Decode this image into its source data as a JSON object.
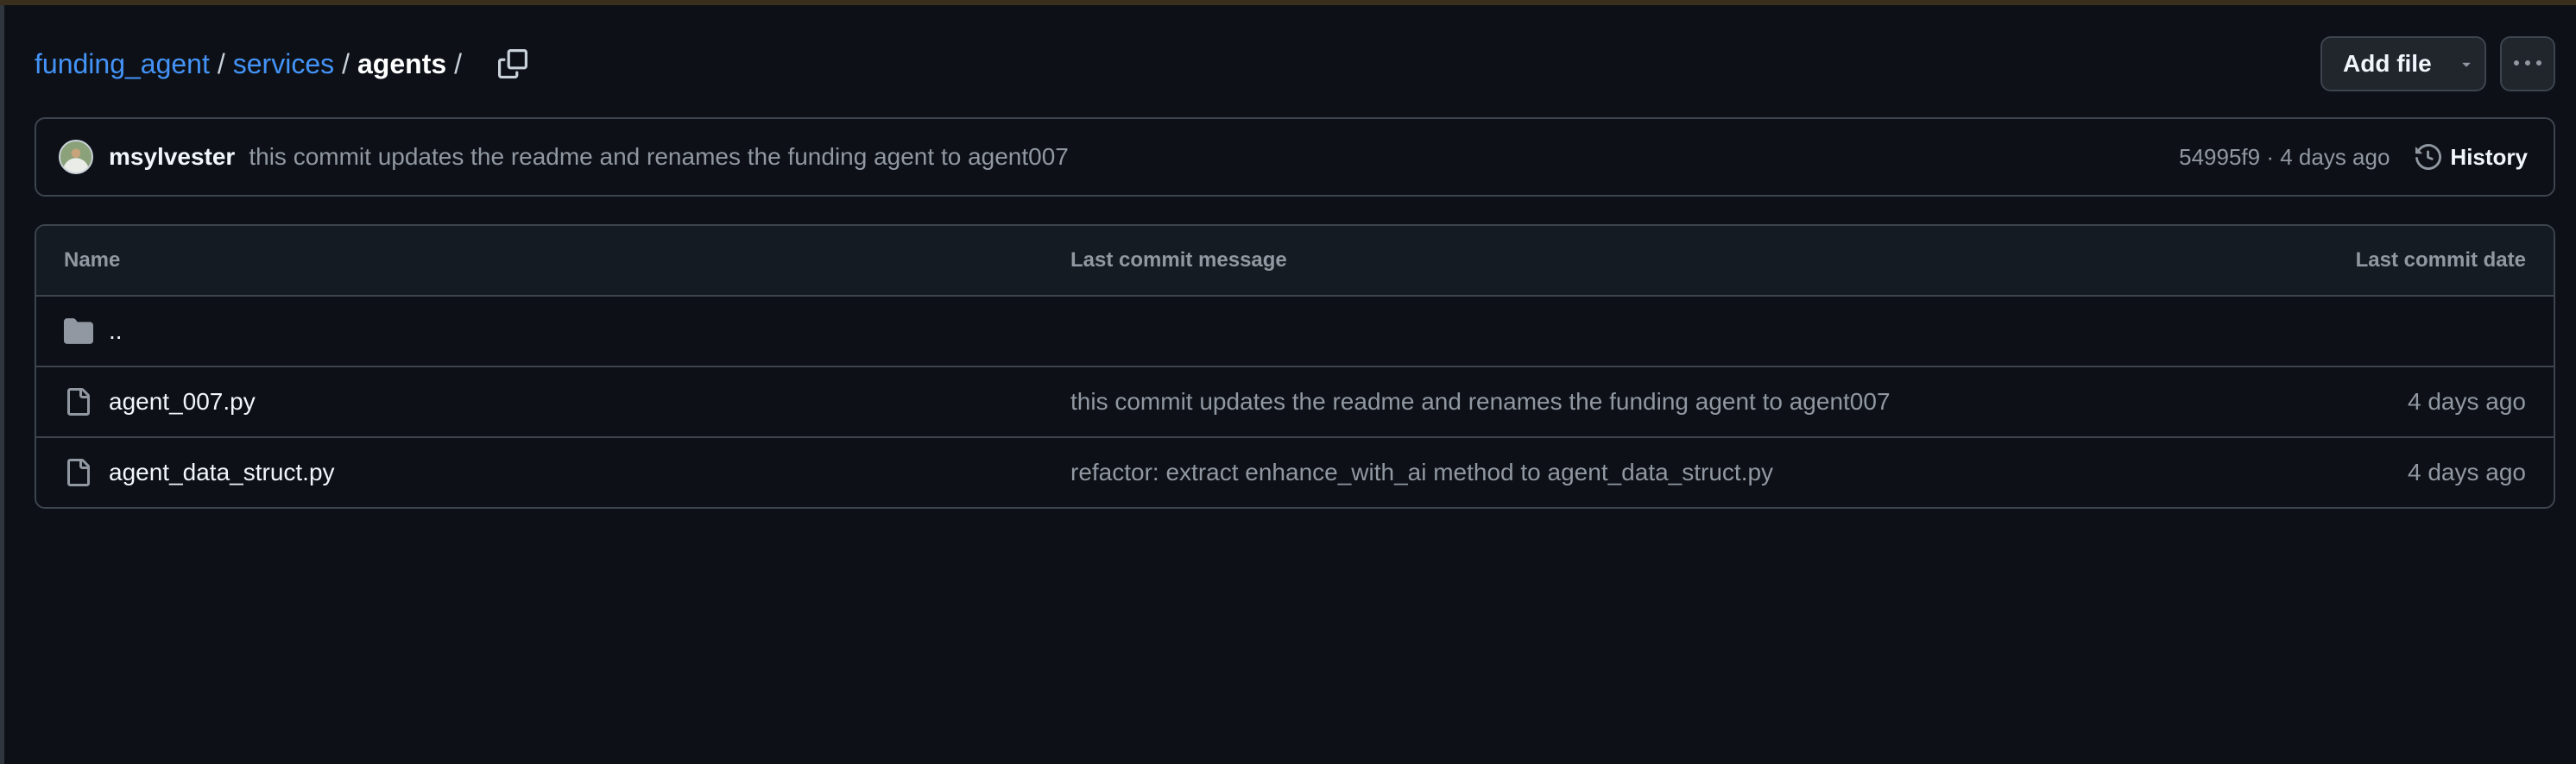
{
  "breadcrumb": {
    "items": [
      "funding_agent",
      "services"
    ],
    "separator": "/",
    "current": "agents",
    "copy_icon": "copy-icon"
  },
  "actions": {
    "add_file_label": "Add file",
    "add_file_caret_icon": "triangle-down-icon",
    "more_icon": "kebab-horizontal-icon"
  },
  "latest_commit": {
    "author": "msylvester",
    "message": "this commit updates the readme and renames the funding agent to agent007",
    "meta": "54995f9 · 4 days ago",
    "history_label": "History",
    "history_icon": "history-icon"
  },
  "file_table": {
    "columns": {
      "name": "Name",
      "message": "Last commit message",
      "date": "Last commit date"
    },
    "rows": [
      {
        "type": "parent",
        "icon": "folder-icon",
        "name": "..",
        "message": "",
        "date": ""
      },
      {
        "type": "file",
        "icon": "file-icon",
        "name": "agent_007.py",
        "message": "this commit updates the readme and renames the funding agent to agent007",
        "date": "4 days ago"
      },
      {
        "type": "file",
        "icon": "file-icon",
        "name": "agent_data_struct.py",
        "message": "refactor: extract enhance_with_ai method to agent_data_struct.py",
        "date": "4 days ago"
      }
    ]
  },
  "colors": {
    "background": "#0d1117",
    "link": "#4493f8",
    "border": "#3d444d",
    "muted_text": "#9198a1",
    "header_bg": "#151b23"
  }
}
